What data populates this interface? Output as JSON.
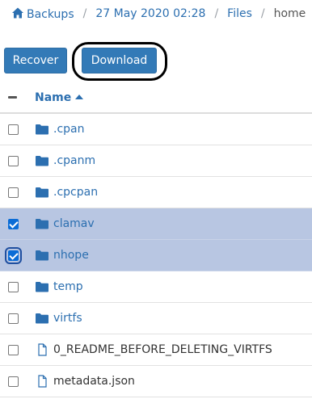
{
  "breadcrumb": {
    "items": [
      "Backups",
      "27 May 2020 02:28",
      "Files"
    ],
    "current": "home",
    "separator": "/"
  },
  "toolbar": {
    "recover_label": "Recover",
    "download_label": "Download"
  },
  "table": {
    "name_header": "Name",
    "sort": "ascending",
    "rows": [
      {
        "name": ".cpan",
        "type": "folder",
        "checked": false
      },
      {
        "name": ".cpanm",
        "type": "folder",
        "checked": false
      },
      {
        "name": ".cpcpan",
        "type": "folder",
        "checked": false
      },
      {
        "name": "clamav",
        "type": "folder",
        "checked": true
      },
      {
        "name": "nhope",
        "type": "folder",
        "checked": true
      },
      {
        "name": "temp",
        "type": "folder",
        "checked": false
      },
      {
        "name": "virtfs",
        "type": "folder",
        "checked": false
      },
      {
        "name": "0_README_BEFORE_DELETING_VIRTFS",
        "type": "file",
        "checked": false
      },
      {
        "name": "metadata.json",
        "type": "file",
        "checked": false
      }
    ]
  },
  "colors": {
    "accent": "#337ab7",
    "link": "#2c6fb0",
    "selected_row": "#b8c6e2",
    "checkbox_checked": "#0a6cd6"
  }
}
